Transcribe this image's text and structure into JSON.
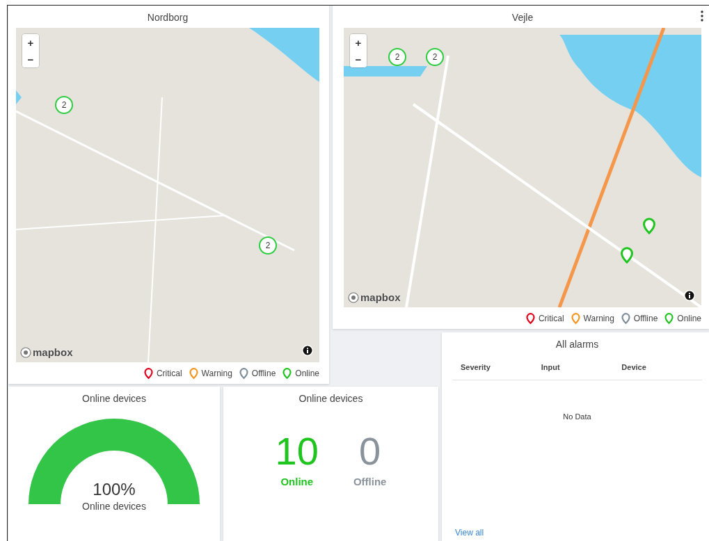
{
  "maps": [
    {
      "title": "Nordborg",
      "zoom_in": "+",
      "zoom_out": "−",
      "attribution": "mapbox",
      "clusters": [
        {
          "count": "2",
          "color": "#2ecc40"
        },
        {
          "count": "2",
          "color": "#2ecc40"
        }
      ],
      "legend": [
        {
          "label": "Critical",
          "color": "#e3001b"
        },
        {
          "label": "Warning",
          "color": "#f7941d"
        },
        {
          "label": "Offline",
          "color": "#7f8c99"
        },
        {
          "label": "Online",
          "color": "#1fc41f"
        }
      ]
    },
    {
      "title": "Vejle",
      "menu": true,
      "zoom_in": "+",
      "zoom_out": "−",
      "attribution": "mapbox",
      "clusters": [
        {
          "count": "2",
          "color": "#2ecc40"
        },
        {
          "count": "2",
          "color": "#2ecc40"
        }
      ],
      "pins": [
        {
          "color": "#1fc41f"
        },
        {
          "color": "#1fc41f"
        }
      ],
      "legend": [
        {
          "label": "Critical",
          "color": "#e3001b"
        },
        {
          "label": "Warning",
          "color": "#f7941d"
        },
        {
          "label": "Offline",
          "color": "#7f8c99"
        },
        {
          "label": "Online",
          "color": "#1fc41f"
        }
      ]
    }
  ],
  "alarms": {
    "title": "All alarms",
    "columns": [
      "Severity",
      "Input",
      "Device"
    ],
    "empty": "No Data",
    "link": "View all"
  },
  "gauge": {
    "title": "Online devices",
    "level": 1.0,
    "value": "100%",
    "caption": "Online devices"
  },
  "counts": {
    "title": "Online devices",
    "items": [
      {
        "value": "10",
        "label": "Online",
        "kind": "online"
      },
      {
        "value": "0",
        "label": "Offline",
        "kind": "offline"
      }
    ]
  }
}
